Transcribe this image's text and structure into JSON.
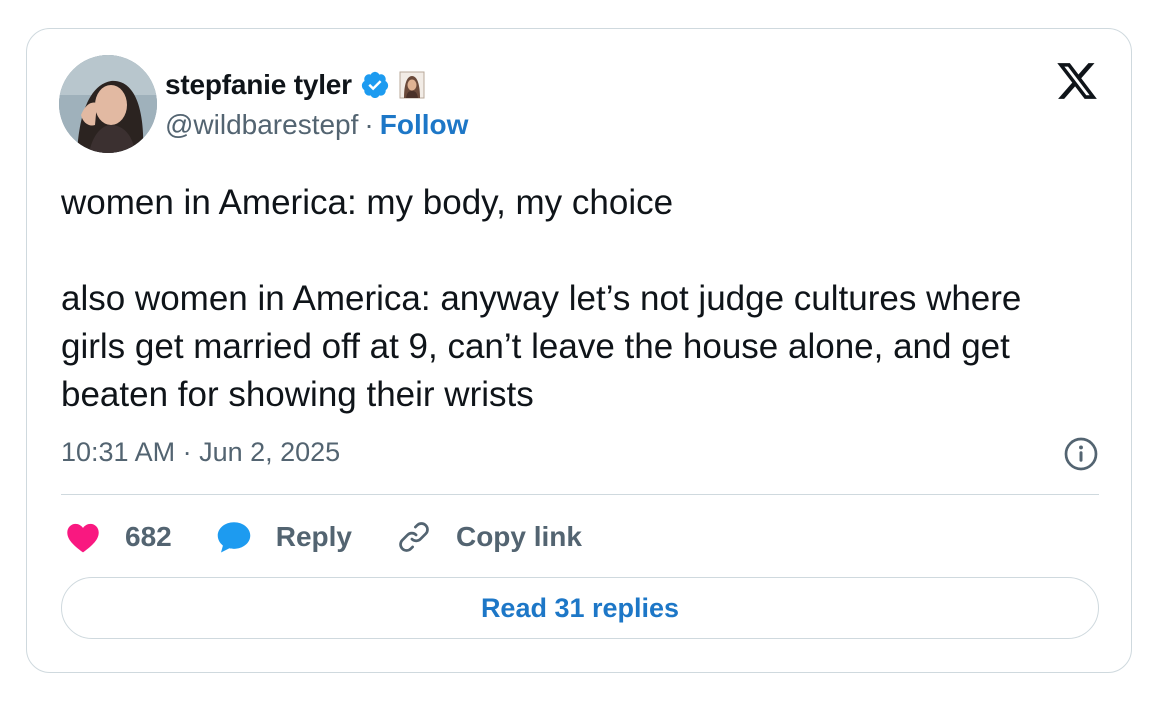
{
  "user": {
    "display_name": "stepfanie tyler",
    "handle": "@wildbarestepf",
    "separator": "·",
    "follow_label": "Follow",
    "verified_icon": "verified-badge-icon",
    "emoji_icon": "hijab-woman-emoji-icon"
  },
  "tweet": {
    "text": "women in America: my body, my choice\n\nalso women in America: anyway let’s not judge cultures where girls get married off at 9, can’t leave the house alone, and get beaten for showing their wrists",
    "timestamp": "10:31 AM · Jun 2, 2025"
  },
  "actions": {
    "like_count": "682",
    "reply_label": "Reply",
    "copy_link_label": "Copy link"
  },
  "read_replies_label": "Read 31 replies",
  "colors": {
    "accent": "#1d77c7",
    "like": "#f91880",
    "reply_icon": "#1d9bf0",
    "text": "#0f1419",
    "muted": "#536471",
    "border": "#cfd9de"
  }
}
